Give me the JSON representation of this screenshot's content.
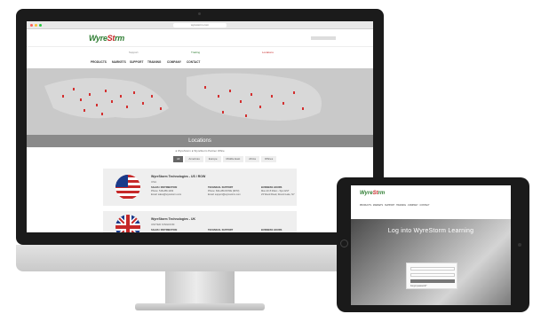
{
  "browser": {
    "url": "wyrestorm.com"
  },
  "site": {
    "logo_main": "Wyre",
    "logo_accent": "St",
    "logo_end": "rm",
    "subbar": [
      "Support",
      "Trading",
      "Locations"
    ],
    "nav": [
      "PRODUCTS",
      "MARKETS",
      "SUPPORT",
      "TRAINING",
      "COMPANY",
      "CONTACT"
    ],
    "map_title": "Locations",
    "legend": "● WyreStorm  ● WyreStorm Partner Office",
    "tabs": [
      "All",
      "Americas",
      "Europe",
      "Middle East",
      "Africa",
      "Offices"
    ],
    "cards": [
      {
        "title": "WyreStorm Technologies - US / ROW",
        "subtitle": "USA",
        "cols": [
          {
            "h": "SALES / DISTRIBUTION",
            "l1": "Phone: 518-289-1293",
            "l2": "Email: sales@wyrestorm.com"
          },
          {
            "h": "TECHNICAL SUPPORT",
            "l1": "Phone: 844-280-WYRE (9973)",
            "l2": "Email: support@wyrestorm.com"
          },
          {
            "h": "BUSINESS HOURS",
            "l1": "Mon-Fri 8:30am - 5pm EST",
            "l2": "23 Wood Road, Round Lake, NY"
          }
        ]
      },
      {
        "title": "WyreStorm Technologies - UK",
        "subtitle": "UNITED KINGDOM",
        "cols": [
          {
            "h": "SALES / DISTRIBUTION",
            "l1": "Phone: +44 (0) 1793 230 343",
            "l2": "Email: sales@wyrestorm.com"
          },
          {
            "h": "TECHNICAL SUPPORT",
            "l1": "Phone: +44 (0) 1793 230 343",
            "l2": "Email: support@wyrestorm.com"
          },
          {
            "h": "BUSINESS HOURS",
            "l1": "Mon-Fri 9am - 5:30pm GMT",
            "l2": "Swindon, United Kingdom"
          }
        ]
      }
    ]
  },
  "tablet": {
    "nav": "PRODUCTS · MARKETS · SUPPORT · TRAINING · COMPANY · CONTACT",
    "hero_title": "Log into WyreStorm Learning",
    "form_link": "Forgot password?"
  },
  "colors": {
    "brand_green": "#2e7d32",
    "brand_red": "#c62828",
    "pin_red": "#d32f2f",
    "map_gray": "#c9c9c9"
  }
}
